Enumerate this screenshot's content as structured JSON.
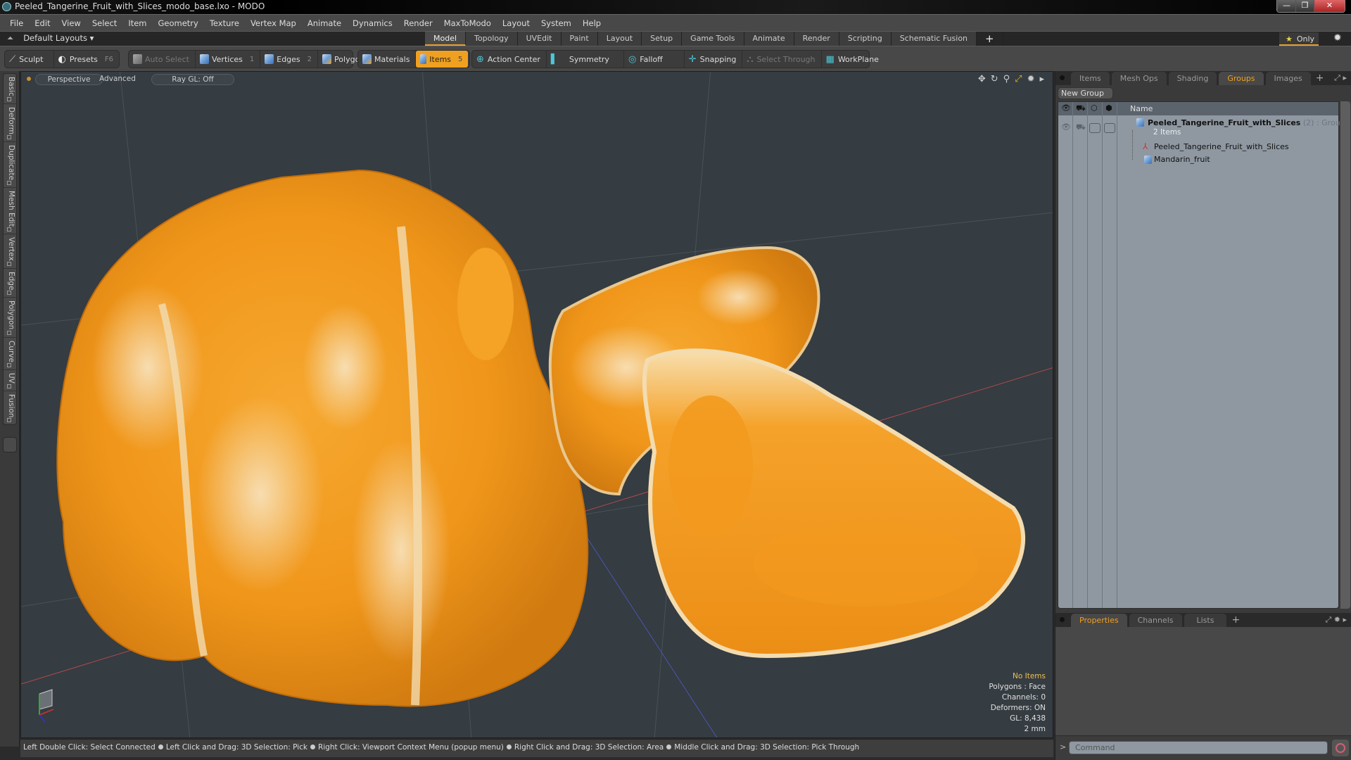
{
  "window": {
    "title": "Peeled_Tangerine_Fruit_with_Slices_modo_base.lxo - MODO",
    "controls": {
      "minimize": "—",
      "restore": "❐",
      "close": "✕"
    }
  },
  "menu": [
    "File",
    "Edit",
    "View",
    "Select",
    "Item",
    "Geometry",
    "Texture",
    "Vertex Map",
    "Animate",
    "Dynamics",
    "Render",
    "MaxToModo",
    "Layout",
    "System",
    "Help"
  ],
  "layoutbar": {
    "layouts_label": "Default Layouts ▾",
    "tabs": [
      "Model",
      "Topology",
      "UVEdit",
      "Paint",
      "Layout",
      "Setup",
      "Game Tools",
      "Animate",
      "Render",
      "Scripting",
      "Schematic Fusion"
    ],
    "active_tab": "Model",
    "add_tab": "+",
    "only_label": "Only"
  },
  "toolbar": {
    "sculpt": "Sculpt",
    "presets": "Presets",
    "presets_key": "F6",
    "auto_select": "Auto Select",
    "vertices": "Vertices",
    "vertices_key": "1",
    "edges": "Edges",
    "edges_key": "2",
    "polygons": "Polygons",
    "materials": "Materials",
    "items": "Items",
    "items_key": "5",
    "action_center": "Action Center",
    "symmetry": "Symmetry",
    "falloff": "Falloff",
    "snapping": "Snapping",
    "select_through": "Select Through",
    "workplane": "WorkPlane"
  },
  "left_tabs": [
    "Basic",
    "Deform",
    "Duplicate",
    "Mesh Edit",
    "Vertex",
    "Edge",
    "Polygon",
    "Curve",
    "UV",
    "Fusion"
  ],
  "viewport": {
    "view_mode": "Perspective",
    "shading": "Advanced",
    "raygl": "Ray GL: Off",
    "hud": {
      "selection": "No Items",
      "polygons": "Polygons : Face",
      "channels": "Channels: 0",
      "deformers": "Deformers: ON",
      "gl": "GL: 8,438",
      "scale": "2 mm"
    },
    "colors": {
      "background": "#353c42",
      "fruit": "#f39a1e",
      "pith": "#f3dcb0"
    }
  },
  "statusbar": [
    "Left Double Click: Select Connected",
    "Left Click and Drag: 3D Selection: Pick",
    "Right Click: Viewport Context Menu (popup menu)",
    "Right Click and Drag: 3D Selection: Area",
    "Middle Click and Drag: 3D Selection: Pick Through"
  ],
  "right_panel": {
    "tabs": [
      "Items",
      "Mesh Ops",
      "Shading",
      "Groups",
      "Images"
    ],
    "active_tab": "Groups",
    "add_tab": "+",
    "new_group": "New Group",
    "column_name": "Name",
    "group": {
      "name": "Peeled_Tangerine_Fruit_with_Slices",
      "count": "(2)",
      "type": ": Group",
      "subtitle": "2 Items",
      "children": [
        {
          "name": "Peeled_Tangerine_Fruit_with_Slices",
          "icon": "locator-icon"
        },
        {
          "name": "Mandarin_fruit",
          "icon": "mesh-icon"
        }
      ]
    }
  },
  "properties_panel": {
    "tabs": [
      "Properties",
      "Channels",
      "Lists"
    ],
    "active_tab": "Properties",
    "add_tab": "+",
    "command_placeholder": "Command",
    "prompt": ">"
  }
}
